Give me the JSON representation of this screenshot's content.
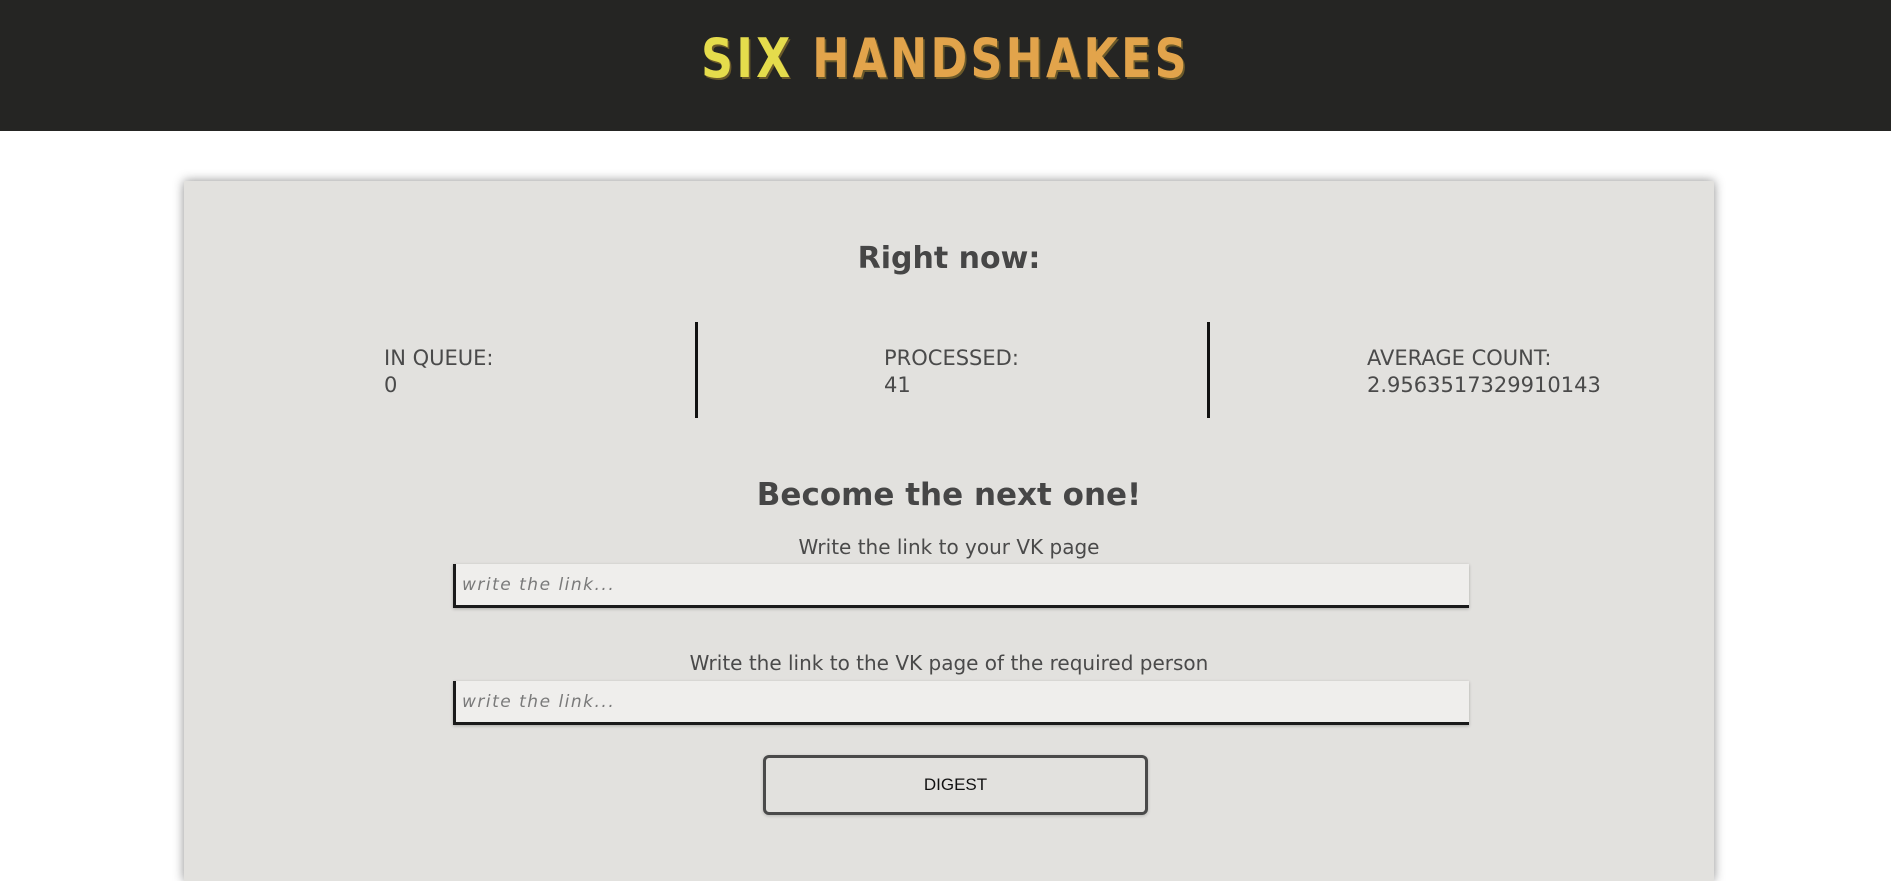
{
  "header": {
    "logo_word1": "SIX",
    "logo_word2": "HANDSHAKES",
    "background_color": "#252523",
    "logo_color_1": "#e5dc4c",
    "logo_color_2": "#e2a44b"
  },
  "stats": {
    "title": "Right now:",
    "in_queue_label": "IN QUEUE:",
    "in_queue_value": "0",
    "processed_label": "PROCESSED:",
    "processed_value": "41",
    "average_label": "AVERAGE COUNT:",
    "average_value": "2.9563517329910143"
  },
  "form": {
    "title": "Become the next one!",
    "field1_label": "Write the link to your VK page",
    "field1_placeholder": "write the link...",
    "field1_value": "",
    "field2_label": "Write the link to the VK page of the required person",
    "field2_placeholder": "write the link...",
    "field2_value": "",
    "submit_label": "DIGEST"
  },
  "colors": {
    "card_background": "#e2e1de",
    "text": "#4a4a4a"
  }
}
